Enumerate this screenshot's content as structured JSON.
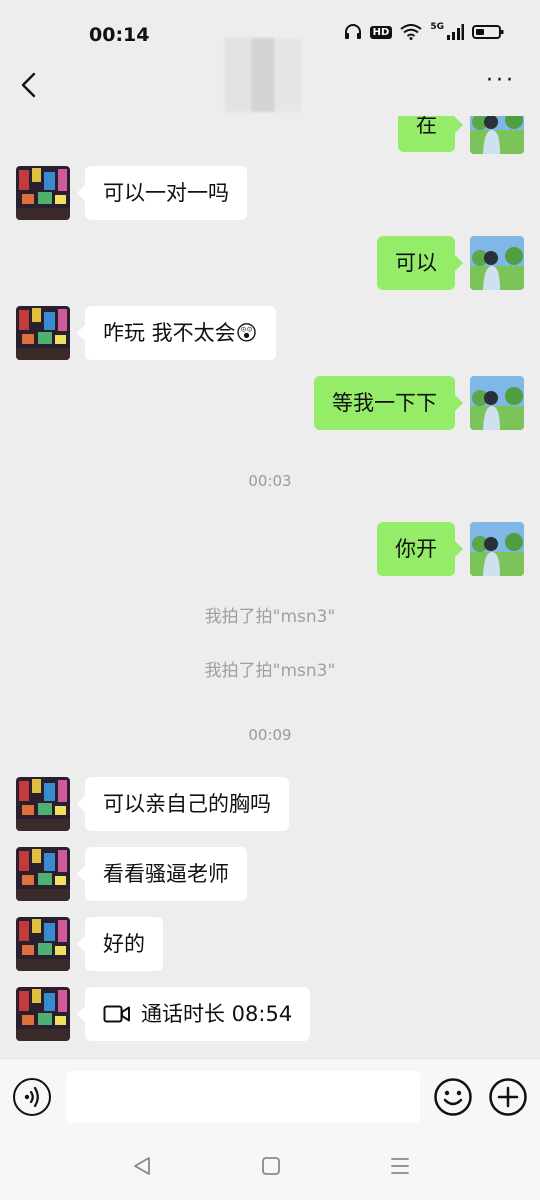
{
  "status": {
    "time": "00:14",
    "hd": "HD",
    "network": "5G"
  },
  "header": {
    "more_label": "···"
  },
  "messages": {
    "m0": "在",
    "m1": "可以一对一吗",
    "m2": "可以",
    "m3": "咋玩 我不太会😲",
    "m4": "等我一下下",
    "ts1": "00:03",
    "m5": "你开",
    "sys1": "我拍了拍\"msn3\"",
    "sys2": "我拍了拍\"msn3\"",
    "ts2": "00:09",
    "m6": "可以亲自己的胸吗",
    "m7": "看看骚逼老师",
    "m8": "好的",
    "m9": "通话时长 08:54"
  },
  "icons": {
    "back": "back-arrow-icon",
    "more": "more-icon",
    "voice": "voice-icon",
    "emoji": "emoji-icon",
    "plus": "plus-icon",
    "video": "video-call-icon"
  },
  "colors": {
    "bubble_out": "#95ec69",
    "bubble_in": "#ffffff",
    "background": "#ededed"
  }
}
